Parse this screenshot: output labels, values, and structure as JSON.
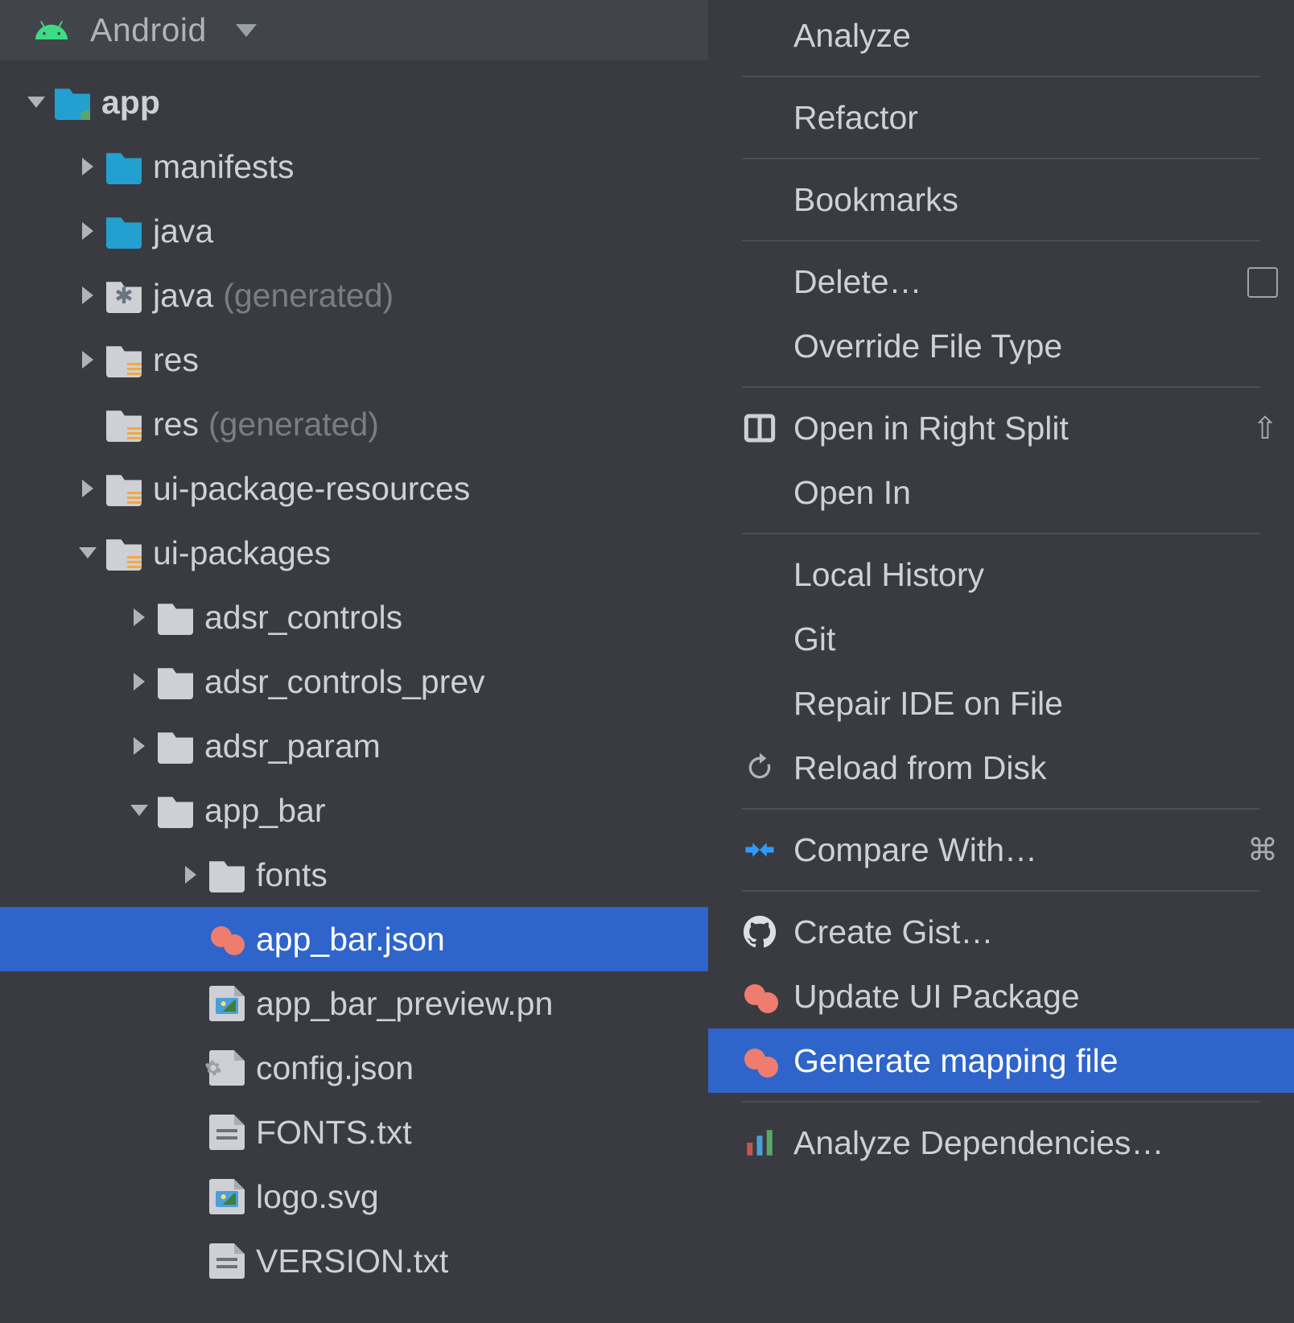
{
  "viewHeader": {
    "title": "Android"
  },
  "tree": [
    {
      "depth": 0,
      "chev": "down",
      "icon": "folder-module-dot",
      "label": "app",
      "bold": true
    },
    {
      "depth": 1,
      "chev": "right",
      "icon": "folder-module",
      "label": "manifests"
    },
    {
      "depth": 1,
      "chev": "right",
      "icon": "folder-module",
      "label": "java"
    },
    {
      "depth": 1,
      "chev": "right",
      "icon": "folder-pinwheel",
      "label": "java",
      "suffix": "(generated)"
    },
    {
      "depth": 1,
      "chev": "right",
      "icon": "folder-lines",
      "label": "res"
    },
    {
      "depth": 1,
      "chev": "",
      "icon": "folder-lines",
      "label": "res",
      "suffix": "(generated)"
    },
    {
      "depth": 1,
      "chev": "right",
      "icon": "folder-lines",
      "label": "ui-package-resources"
    },
    {
      "depth": 1,
      "chev": "down",
      "icon": "folder-lines",
      "label": "ui-packages"
    },
    {
      "depth": 2,
      "chev": "right",
      "icon": "folder",
      "label": "adsr_controls"
    },
    {
      "depth": 2,
      "chev": "right",
      "icon": "folder",
      "label": "adsr_controls_prev"
    },
    {
      "depth": 2,
      "chev": "right",
      "icon": "folder",
      "label": "adsr_param"
    },
    {
      "depth": 2,
      "chev": "down",
      "icon": "folder",
      "label": "app_bar"
    },
    {
      "depth": 3,
      "chev": "right",
      "icon": "folder",
      "label": "fonts"
    },
    {
      "depth": 3,
      "chev": "",
      "icon": "peanut",
      "label": "app_bar.json",
      "selected": true
    },
    {
      "depth": 3,
      "chev": "",
      "icon": "file-image",
      "label": "app_bar_preview.pn"
    },
    {
      "depth": 3,
      "chev": "",
      "icon": "file-gear",
      "label": "config.json"
    },
    {
      "depth": 3,
      "chev": "",
      "icon": "file-text",
      "label": "FONTS.txt"
    },
    {
      "depth": 3,
      "chev": "",
      "icon": "file-image",
      "label": "logo.svg"
    },
    {
      "depth": 3,
      "chev": "",
      "icon": "file-text",
      "label": "VERSION.txt"
    }
  ],
  "menu": [
    {
      "type": "item",
      "label": "Analyze"
    },
    {
      "type": "sep"
    },
    {
      "type": "item",
      "label": "Refactor"
    },
    {
      "type": "sep"
    },
    {
      "type": "item",
      "label": "Bookmarks"
    },
    {
      "type": "sep"
    },
    {
      "type": "item",
      "label": "Delete…",
      "shortcut": "box"
    },
    {
      "type": "item",
      "label": "Override File Type"
    },
    {
      "type": "sep"
    },
    {
      "type": "item",
      "label": "Open in Right Split",
      "icon": "split",
      "shortcut": "⇧"
    },
    {
      "type": "item",
      "label": "Open In"
    },
    {
      "type": "sep"
    },
    {
      "type": "item",
      "label": "Local History"
    },
    {
      "type": "item",
      "label": "Git"
    },
    {
      "type": "item",
      "label": "Repair IDE on File"
    },
    {
      "type": "item",
      "label": "Reload from Disk",
      "icon": "reload"
    },
    {
      "type": "sep"
    },
    {
      "type": "item",
      "label": "Compare With…",
      "icon": "compare",
      "shortcut": "⌘"
    },
    {
      "type": "sep"
    },
    {
      "type": "item",
      "label": "Create Gist…",
      "icon": "github"
    },
    {
      "type": "item",
      "label": "Update UI Package",
      "icon": "peanut"
    },
    {
      "type": "item",
      "label": "Generate mapping file",
      "icon": "peanut",
      "selected": true
    },
    {
      "type": "sep"
    },
    {
      "type": "item",
      "label": "Analyze Dependencies…",
      "icon": "bars"
    }
  ]
}
